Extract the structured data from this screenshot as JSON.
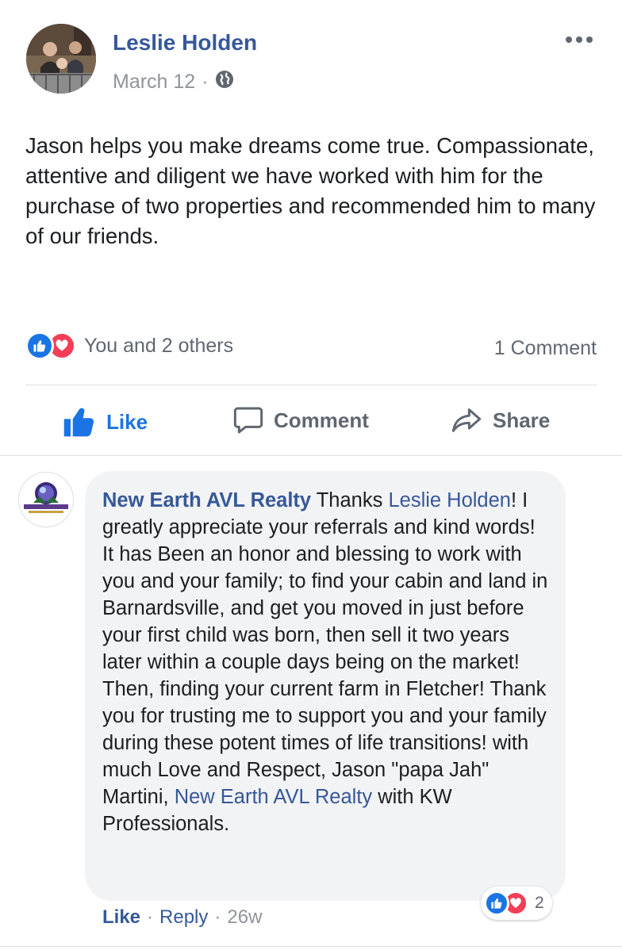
{
  "post": {
    "author": "Leslie Holden",
    "date": "March 12",
    "date_separator": "·",
    "body": "Jason helps you make dreams come true. Compassionate, attentive and diligent we have worked with him for the purchase of two properties and recommended him to many of our friends.",
    "reactions_text": "You and 2 others",
    "comment_count": "1 Comment",
    "icons": {
      "privacy": "globe-icon",
      "more": "more-options-icon"
    }
  },
  "actions": {
    "like": "Like",
    "comment": "Comment",
    "share": "Share"
  },
  "comment": {
    "author": "New Earth AVL Realty",
    "text_1": " Thanks ",
    "mention_1": "Leslie Holden",
    "text_2": "! I greatly appreciate your referrals and kind words! It has Been an honor and blessing to work with you and your family; to find your cabin and land in Barnardsville, and get you moved in just before your first child was born, then sell it two years later within a couple days being on the market! Then, finding your current farm in Fletcher! Thank you for trusting me to support you and your family during these potent times of life transitions! with much Love and Respect, Jason \"papa Jah\" Martini, ",
    "mention_2": "New Earth AVL Realty",
    "text_3": " with KW Professionals.",
    "reaction_count": "2",
    "like_label": "Like",
    "reply_label": "Reply",
    "age": "26w",
    "separator": "·",
    "avatar_text": "New Earth AVL Realty"
  },
  "colors": {
    "link": "#365899",
    "like_blue": "#1b74e4",
    "love_red": "#f33e58",
    "muted": "#606770",
    "bubble": "#f2f3f5"
  }
}
